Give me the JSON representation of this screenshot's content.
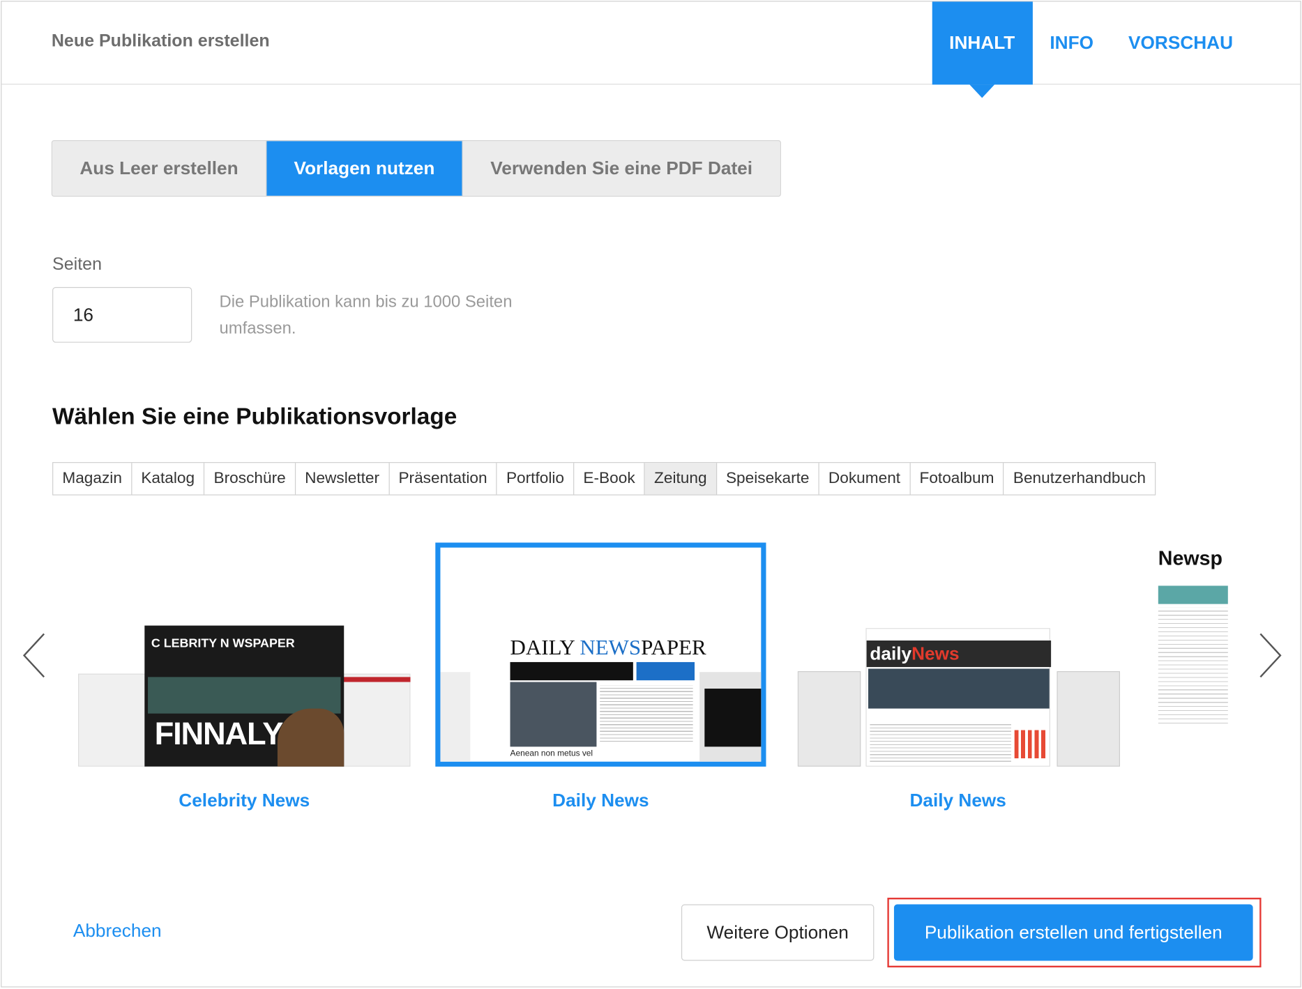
{
  "header": {
    "title": "Neue Publikation erstellen",
    "tabs": [
      "INHALT",
      "INFO",
      "VORSCHAU"
    ]
  },
  "mode": {
    "options": [
      "Aus Leer erstellen",
      "Vorlagen nutzen",
      "Verwenden Sie eine PDF Datei"
    ],
    "selected": "Vorlagen nutzen"
  },
  "pages": {
    "label": "Seiten",
    "value": "16",
    "hint": "Die Publikation kann bis zu 1000 Seiten umfassen."
  },
  "templates": {
    "title": "Wählen Sie eine Publikationsvorlage",
    "categories": [
      "Magazin",
      "Katalog",
      "Broschüre",
      "Newsletter",
      "Präsentation",
      "Portfolio",
      "E-Book",
      "Zeitung",
      "Speisekarte",
      "Dokument",
      "Fotoalbum",
      "Benutzerhandbuch"
    ],
    "selected_category": "Zeitung",
    "items": [
      {
        "label": "Celebrity News"
      },
      {
        "label": "Daily News"
      },
      {
        "label": "Daily News"
      }
    ],
    "thumb_text": {
      "t1_mast": "C LEBRITY N WSPAPER",
      "t1_headline": "FINNALY",
      "t2_logo_a": "DAILY ",
      "t2_logo_b": "NEWS",
      "t2_logo_c": "PAPER",
      "t2_bottom": "Aenean non metus vel",
      "t3_mast_a": "daily",
      "t3_mast_b": "News",
      "t4_mast": "Newsp"
    }
  },
  "footer": {
    "cancel": "Abbrechen",
    "more": "Weitere Optionen",
    "create": "Publikation erstellen und fertigstellen"
  },
  "colors": {
    "accent": "#1c8ef0",
    "highlight_border": "#e53935"
  }
}
